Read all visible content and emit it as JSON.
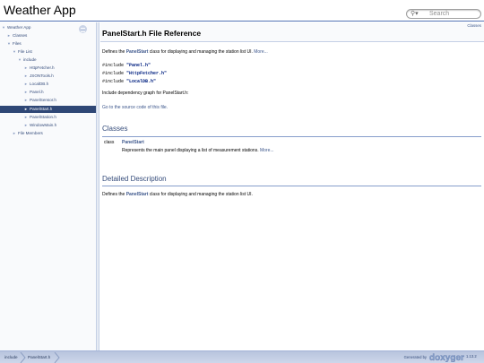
{
  "app": {
    "project_name": "Weather App"
  },
  "search": {
    "placeholder": "Search"
  },
  "sidebar": {
    "items": [
      {
        "label": "Weather App",
        "arrow": "▼"
      },
      {
        "label": "Classes",
        "arrow": "►"
      },
      {
        "label": "Files",
        "arrow": "▼"
      },
      {
        "label": "File List",
        "arrow": "▼"
      },
      {
        "label": "include",
        "arrow": "▼"
      },
      {
        "label": "HttpFetcher.h",
        "arrow": "►"
      },
      {
        "label": "JSONTools.h",
        "arrow": "►"
      },
      {
        "label": "LocalDB.h",
        "arrow": "►"
      },
      {
        "label": "Panel.h",
        "arrow": "►"
      },
      {
        "label": "PanelSensor.h",
        "arrow": "►"
      },
      {
        "label": "PanelStart.h",
        "arrow": "►"
      },
      {
        "label": "PanelStation.h",
        "arrow": "►"
      },
      {
        "label": "WindowMain.h",
        "arrow": "►"
      },
      {
        "label": "File Members",
        "arrow": "►"
      }
    ]
  },
  "header": {
    "summary_link": "Classes",
    "title": "PanelStart.h File Reference"
  },
  "brief": {
    "pre": "Defines the ",
    "cls": "PanelStart",
    "post": " class for displaying and managing the station list UI. ",
    "more": "More..."
  },
  "includes": [
    {
      "kw": "#include ",
      "file": "\"Panel.h\""
    },
    {
      "kw": "#include ",
      "file": "\"HttpFetcher.h\""
    },
    {
      "kw": "#include ",
      "file": "\"LocalDB.h\""
    }
  ],
  "dep_graph_text": "Include dependency graph for PanelStart.h:",
  "source_link": "Go to the source code of this file.",
  "classes_section": {
    "heading": "Classes",
    "rows": [
      {
        "kind": "class",
        "name": "PanelStart",
        "desc": "Represents the main panel displaying a list of measurement stations. ",
        "more": "More..."
      }
    ]
  },
  "detailed": {
    "heading": "Detailed Description",
    "pre": "Defines the ",
    "cls": "PanelStart",
    "post": " class for displaying and managing the station list UI."
  },
  "footer": {
    "breadcrumbs": [
      "include",
      "PanelStart.h"
    ],
    "generated_by": "Generated by",
    "logo_text": "doxygen",
    "version": "1.13.2"
  },
  "colors": {
    "accent": "#3d578c",
    "selected": "#2f4776",
    "navbar": "#b8c4dd"
  }
}
